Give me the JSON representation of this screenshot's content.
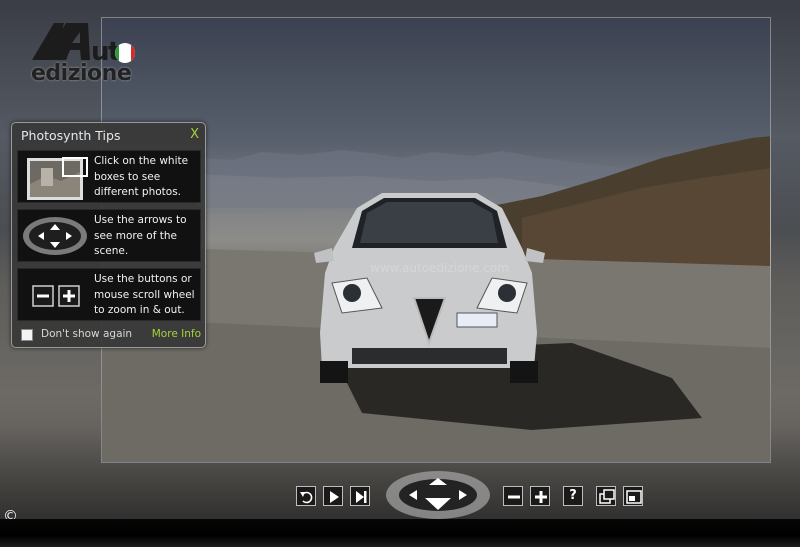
{
  "logo": {
    "mark": "AUTO",
    "subtitle": "edizione",
    "flag_colors": [
      "#2e9b3b",
      "#ffffff",
      "#d42a2a"
    ]
  },
  "scene": {
    "watermark": "www.autoedizione.com"
  },
  "tips": {
    "title": "Photosynth Tips",
    "close_label": "X",
    "items": [
      {
        "icon": "photo-thumbnail-icon",
        "text": "Click on the white boxes to see different photos."
      },
      {
        "icon": "arrows-pad-icon",
        "text": "Use the arrows to see more of the scene."
      },
      {
        "icon": "zoom-buttons-icon",
        "text": "Use the buttons or mouse scroll wheel to zoom in & out."
      }
    ],
    "dont_show_label": "Don't show again",
    "more_info_label": "More Info"
  },
  "toolbar": {
    "buttons": [
      "undo-icon",
      "play-icon",
      "next-icon",
      "arrows-pad-icon",
      "zoom-out-icon",
      "zoom-in-icon",
      "help-icon",
      "overlay-icon",
      "fullscreen-icon"
    ],
    "help_label": "?"
  },
  "copyright": "©",
  "colors": {
    "accent": "#a6d13a",
    "panel_bg": "#373737",
    "button_border": "#bdbdbd"
  }
}
